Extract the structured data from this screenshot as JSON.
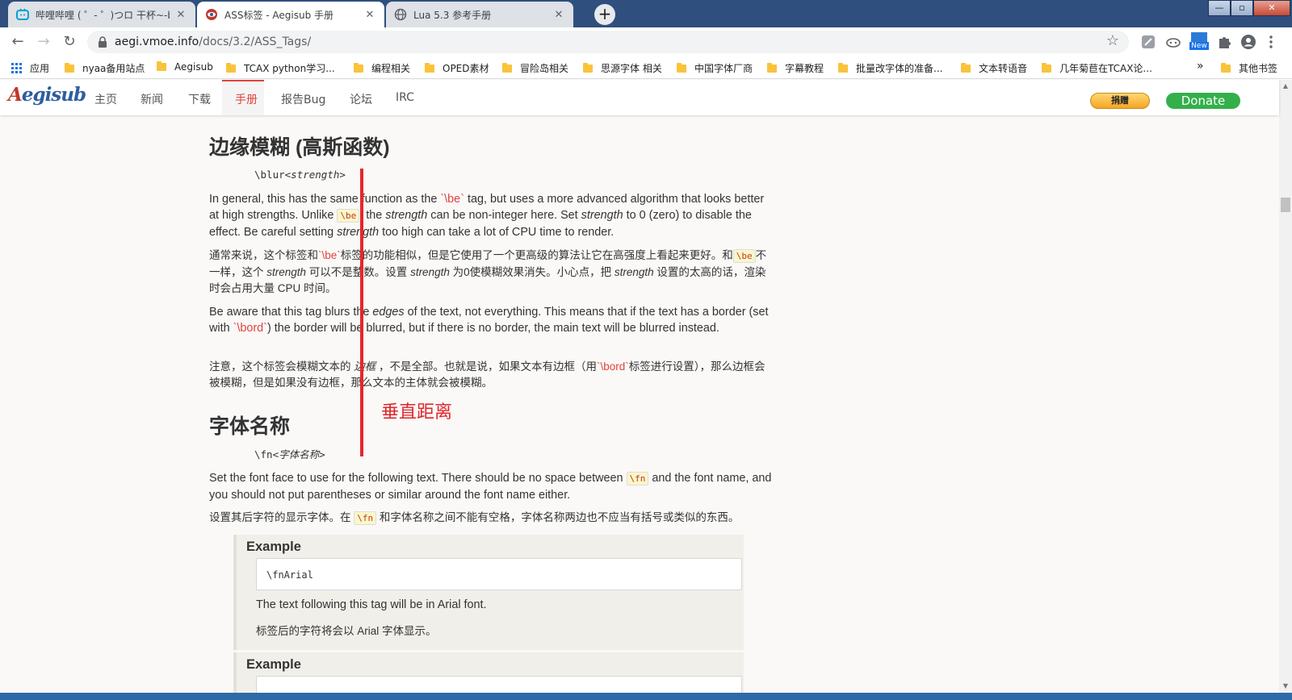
{
  "browser": {
    "tabs": [
      {
        "title": "哔哩哔哩 ( ゜- ゜)つロ 干杯~-bili",
        "active": false,
        "favicon": "bilibili-icon",
        "favicon_color": "#00a1d6"
      },
      {
        "title": "ASS标签 - Aegisub 手册",
        "active": true,
        "favicon": "aegisub-icon",
        "favicon_color": "#c0392b"
      },
      {
        "title": "Lua 5.3 参考手册",
        "active": false,
        "favicon": "globe-icon",
        "favicon_color": "#5f6368"
      }
    ],
    "tab_close_glyph": "✕",
    "new_tab_glyph": "+",
    "window_controls": {
      "minimize": "—",
      "maximize": "▫",
      "close": "✕"
    },
    "url": {
      "host": "aegi.vmoe.info",
      "path": "/docs/3.2/ASS_Tags/"
    },
    "nav_glyphs": {
      "back": "←",
      "forward": "→",
      "reload": "↻",
      "star": "☆"
    },
    "extension_badge": "New",
    "bookmarks": {
      "apps_label": "应用",
      "items": [
        "nyaa备用站点",
        "Aegisub",
        "TCAX python学习...",
        "编程相关",
        "OPED素材",
        "冒险岛相关",
        "思源字体 相关",
        "中国字体厂商",
        "字幕教程",
        "批量改字体的准备...",
        "文本转语音",
        "几年菊苣在TCAX论..."
      ],
      "overflow": "»",
      "other": "其他书签"
    }
  },
  "site": {
    "logo": {
      "first": "A",
      "rest": "egisub"
    },
    "nav": [
      "主页",
      "新闻",
      "下载",
      "手册",
      "报告Bug",
      "论坛",
      "IRC"
    ],
    "active_nav": "手册",
    "give_button": "捐赠",
    "donate_button": "Donate",
    "accent_color": "#e0433a"
  },
  "article": {
    "section1": {
      "heading": "边缘模糊 (高斯函数)",
      "syntax_tag": "\\blur",
      "syntax_param": "<strength>",
      "p1": {
        "a": "In general, this has the same function as the ",
        "tag1": "`\\be`",
        "b": " tag, but uses a more advanced algorithm that looks better at high strengths. Unlike ",
        "code": "\\be",
        "c": ", the ",
        "em1": "strength",
        "d": " can be non-integer here. Set ",
        "em2": "strength",
        "e": " to 0 (zero) to disable the effect. Be careful setting ",
        "em3": "strength",
        "f": " too high can take a lot of CPU time to render."
      },
      "p2": {
        "a": "通常来说，这个标签和",
        "tag1": "`\\be`",
        "b": "标签的功能相似，但是它使用了一个更高级的算法让它在高强度上看起来更好。和",
        "code": "\\be",
        "c": "不一样，这个 ",
        "em1": "strength",
        "d": " 可以不是整数。设置 ",
        "em2": "strength",
        "e": " 为0使模糊效果消失。小心点，把 ",
        "em3": "strength",
        "f": " 设置的太高的话，渲染时会占用大量 CPU 时间。"
      },
      "p3": {
        "a": "Be aware that this tag blurs the ",
        "em1": "edges",
        "b": " of the text, not everything. This means that if the text has a border (set with ",
        "tag1": "`\\bord`",
        "c": ") the border will be blurred, but if there is no border, the main text will be blurred instead."
      },
      "p4": {
        "a": "注意，这个标签会模糊文本的 ",
        "em1": "边框",
        "b": " ，不是全部。也就是说，如果文本有边框（用",
        "tag1": "`\\bord`",
        "c": "标签进行设置），那么边框会被模糊，但是如果没有边框，那么文本的主体就会被模糊。"
      }
    },
    "section2": {
      "heading": "字体名称",
      "syntax_tag": "\\fn",
      "syntax_param": "<字体名称>",
      "p1": {
        "a": "Set the font face to use for the following text. There should be no space between ",
        "code": "\\fn",
        "b": " and the font name, and you should not put parentheses or similar around the font name either."
      },
      "p2": {
        "a": "设置其后字符的显示字体。在 ",
        "code": "\\fn",
        "b": " 和字体名称之间不能有空格，字体名称两边也不应当有括号或类似的东西。"
      },
      "example1": {
        "title": "Example",
        "code": "\\fnArial",
        "text_en": "The text following this tag will be in Arial font.",
        "text_zh": "标签后的字符将会以 Arial 字体显示。"
      },
      "example2": {
        "title": "Example"
      }
    }
  },
  "annotation": {
    "label": "垂直距离",
    "color": "#e8262b"
  },
  "scrollbar": {
    "up_glyph": "▲",
    "down_glyph": "▼"
  }
}
